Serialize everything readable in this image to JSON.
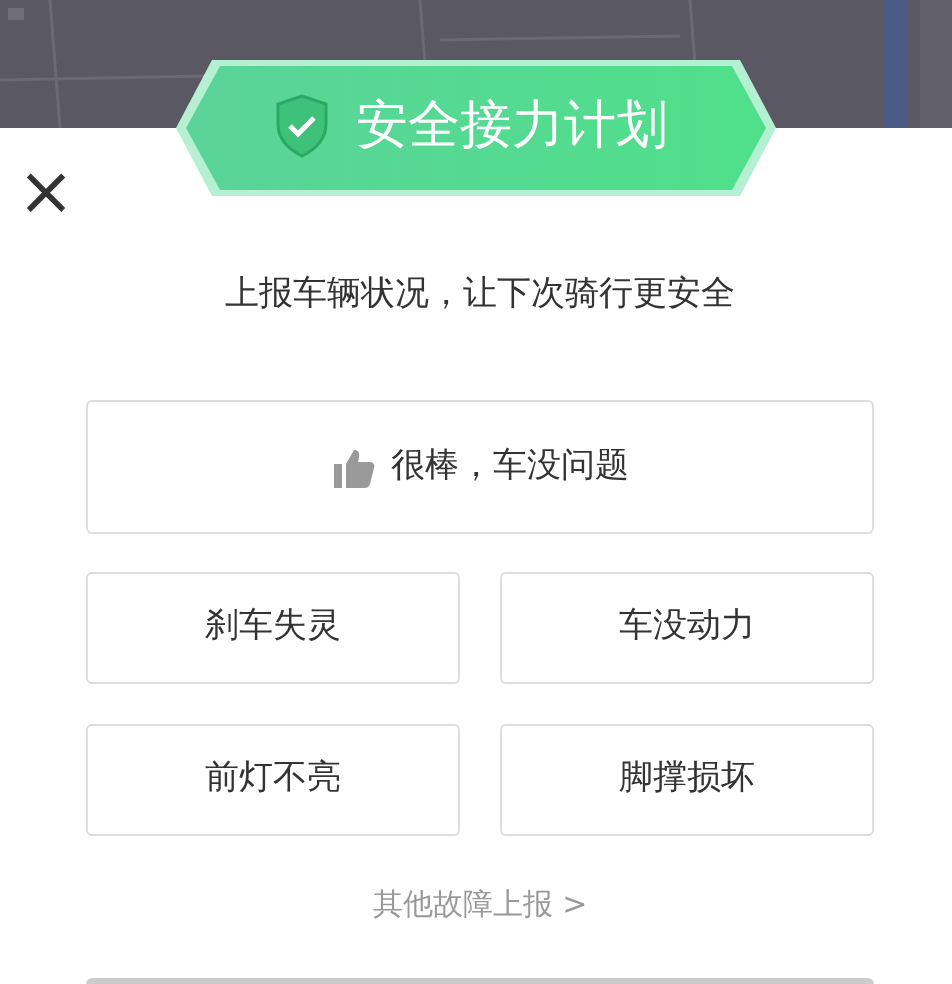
{
  "banner": {
    "title": "安全接力计划"
  },
  "close_label": "×",
  "subtitle": "上报车辆状况，让下次骑行更安全",
  "primary_option": {
    "label": "很棒，车没问题"
  },
  "options": [
    {
      "label": "刹车失灵"
    },
    {
      "label": "车没动力"
    },
    {
      "label": "前灯不亮"
    },
    {
      "label": "脚撑损坏"
    }
  ],
  "other_link": "其他故障上报 >"
}
